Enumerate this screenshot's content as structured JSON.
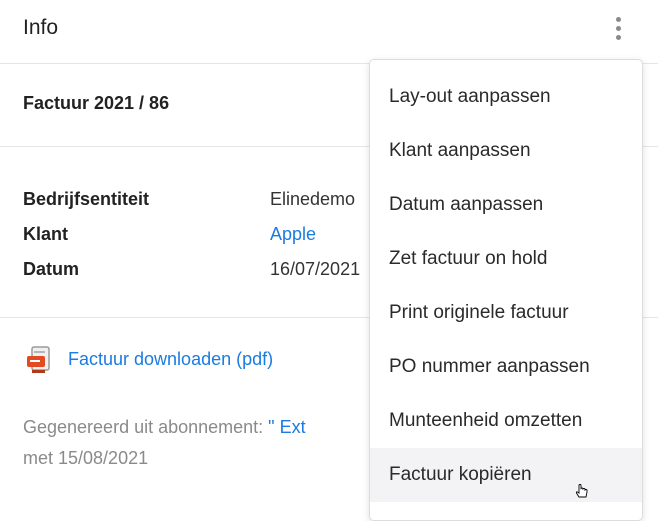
{
  "header": {
    "title": "Info"
  },
  "invoice": {
    "title": "Factuur 2021 / 86"
  },
  "details": [
    {
      "label": "Bedrijfsentiteit",
      "value": "Elinedemo"
    },
    {
      "label": "Klant",
      "value": "Apple"
    },
    {
      "label": "Datum",
      "value": "16/07/2021"
    }
  ],
  "download": {
    "label": "Factuur downloaden (pdf)",
    "icon": "pdf-file-icon"
  },
  "generated": {
    "prefix": "Gegenereerd uit abonnement: ",
    "link": "\" Ext",
    "suffix": "met 15/08/2021"
  },
  "menu": {
    "items": [
      "Lay-out aanpassen",
      "Klant aanpassen",
      "Datum aanpassen",
      "Zet factuur on hold",
      "Print originele factuur",
      "PO nummer aanpassen",
      "Munteenheid omzetten",
      "Factuur kopiëren"
    ]
  },
  "colors": {
    "link": "#1a7be0",
    "muted": "#8a8a8a",
    "hover": "#f3f3f5"
  }
}
